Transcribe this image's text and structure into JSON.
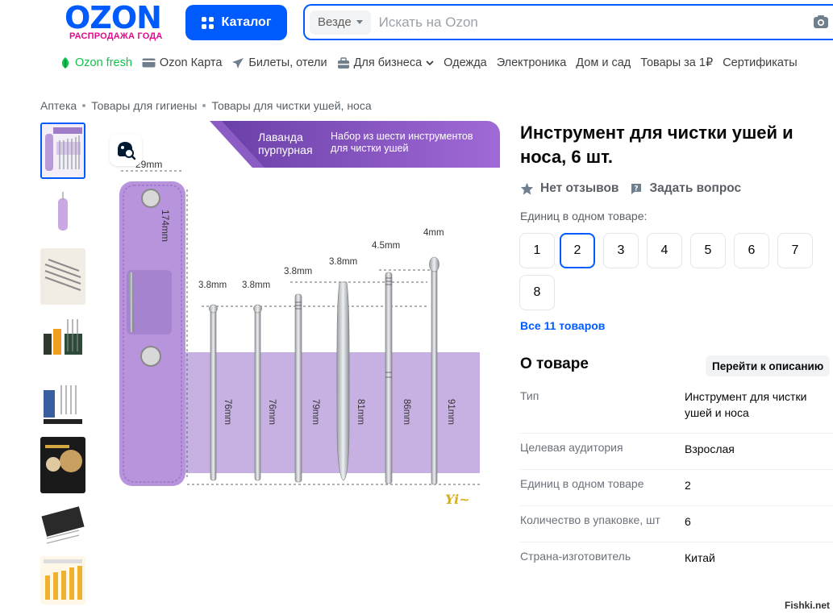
{
  "header": {
    "logo": "OZON",
    "logo_sub": "РАСПРОДАЖА ГОДА",
    "catalog_label": "Каталог",
    "search_scope": "Везде",
    "search_placeholder": "Искать на Ozon"
  },
  "nav": {
    "items": [
      {
        "label": "Ozon fresh",
        "icon": "ozon-fresh-icon"
      },
      {
        "label": "Ozon Карта",
        "icon": "card-icon"
      },
      {
        "label": "Билеты, отели",
        "icon": "plane-icon"
      },
      {
        "label": "Для бизнеса",
        "icon": "briefcase-icon"
      },
      {
        "label": "Одежда"
      },
      {
        "label": "Электроника"
      },
      {
        "label": "Дом и сад"
      },
      {
        "label": "Товары за 1₽"
      },
      {
        "label": "Сертификаты"
      }
    ]
  },
  "breadcrumbs": [
    "Аптека",
    "Товары для гигиены",
    "Товары для чистки ушей, носа"
  ],
  "gallery": {
    "banner_left": "Лаванда пурпурная",
    "banner_right": "Набор из шести инструментов для чистки ушей",
    "case_width": "29mm",
    "case_height": "174mm",
    "tool_tips": [
      "3.8mm",
      "3.8mm",
      "3.8mm",
      "3.8mm",
      "4.5mm",
      "4mm"
    ],
    "tool_lengths": [
      "76mm",
      "76mm",
      "79mm",
      "81mm",
      "86mm",
      "91mm"
    ],
    "brand_mark": "Yi~"
  },
  "product": {
    "title": "Инструмент для чистки ушей и носа, 6 шт.",
    "reviews": "Нет отзывов",
    "ask": "Задать вопрос",
    "units_label": "Единиц в одном товаре:",
    "units_options": [
      "1",
      "2",
      "3",
      "4",
      "5",
      "6",
      "7",
      "8"
    ],
    "units_selected": "2",
    "all_products": "Все 11 товаров"
  },
  "about": {
    "title": "О товаре",
    "goto": "Перейти к описанию",
    "specs": [
      {
        "key": "Тип",
        "value": "Инструмент для чистки ушей и носа"
      },
      {
        "key": "Целевая аудитория",
        "value": "Взрослая"
      },
      {
        "key": "Единиц в одном товаре",
        "value": "2"
      },
      {
        "key": "Количество в упаковке, шт",
        "value": "6"
      },
      {
        "key": "Страна-изготовитель",
        "value": "Китай"
      }
    ]
  },
  "watermark": "Fishki.net",
  "colors": {
    "brand": "#005bff",
    "accent": "#e5098c",
    "lavender": "#b89ad8"
  }
}
